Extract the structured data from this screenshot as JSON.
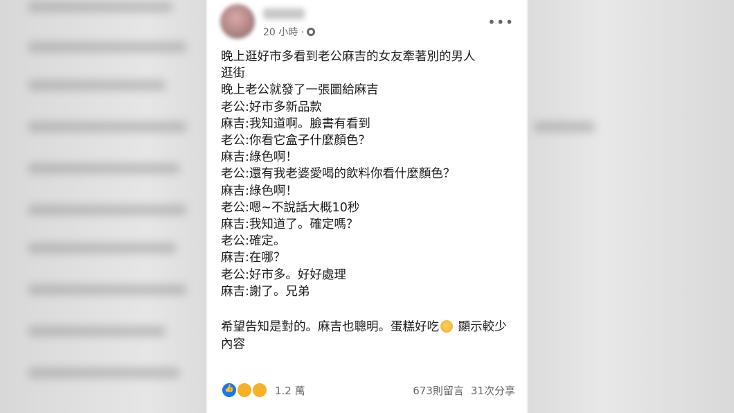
{
  "post": {
    "timestamp": "20 小時 ·",
    "more_label": "•••",
    "lines": [
      "晚上逛好市多看到老公麻吉的女友牽著別的男人",
      "逛街",
      "晚上老公就發了一張圖給麻吉",
      "老公:好市多新品款",
      "麻吉:我知道啊。臉書有看到",
      "老公:你看它盒子什麼顏色？",
      "麻吉:綠色啊！",
      "老公:還有我老婆愛喝的飲料你看什麼顏色？",
      "麻吉:綠色啊！",
      "老公:嗯~不說話大概10秒",
      "麻吉:我知道了。確定嗎？",
      "老公:確定。",
      "麻吉:在哪？",
      "老公:好市多。好好處理",
      "麻吉:謝了。兄弟"
    ],
    "closing_text": "希望告知是對的。麻吉也聰明。蛋糕好吃",
    "see_more": "顯示較少內容",
    "closing_emoji": "smiling-face-icon"
  },
  "footer": {
    "reaction_icons": [
      "like-icon",
      "haha-icon",
      "wow-icon"
    ],
    "reaction_count": "1.2 萬",
    "comments": "673則留言",
    "shares": "31次分享"
  }
}
